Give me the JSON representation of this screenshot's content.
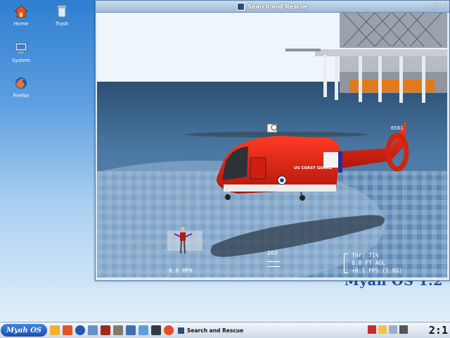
{
  "desktop": {
    "icons": [
      {
        "label": "Home",
        "icon": "home-icon"
      },
      {
        "label": "Trash",
        "icon": "trash-icon"
      },
      {
        "label": "System",
        "icon": "computer-icon"
      },
      {
        "label": "Firefox",
        "icon": "firefox-icon"
      }
    ],
    "brand": "Myah OS 1.2"
  },
  "window": {
    "title": "Search and Rescue",
    "hud": {
      "heading": "263",
      "speed": "0.0 MPH",
      "throttle": "Thr: 71%",
      "altitude": "8.8 FT AGL",
      "fps": "+0.1 FPS (1.0G)"
    },
    "helicopter": {
      "tail_number": "6561",
      "fuselage_text": "US COAST GUARD"
    }
  },
  "taskbar": {
    "start_label": "Myah OS",
    "task_label": "Search and Rescue",
    "clock": "2:1",
    "colors": {
      "start": "#2a6ad0",
      "taskbar": "#dde6f0"
    }
  }
}
